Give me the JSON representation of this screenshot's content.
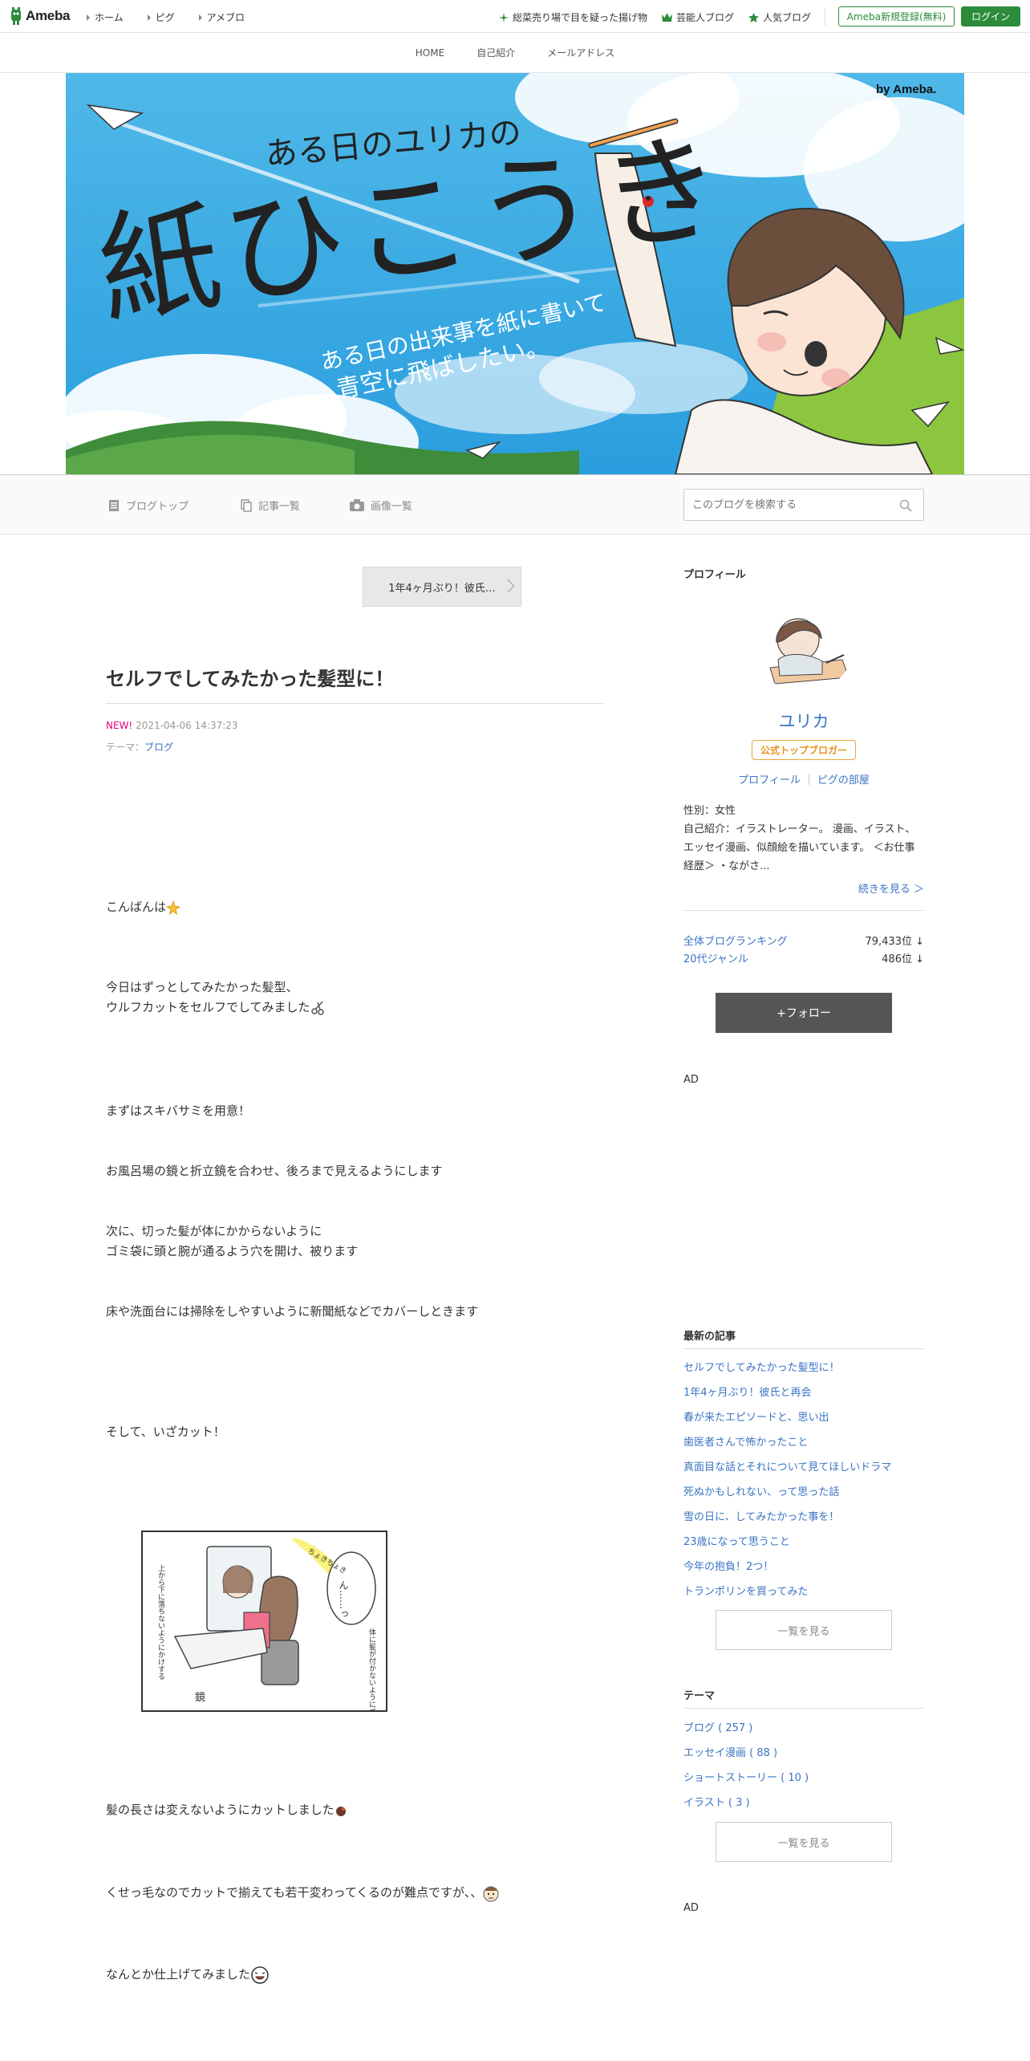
{
  "topbar": {
    "logo_text": "Ameba",
    "nav": [
      "ホーム",
      "ピグ",
      "アメブロ"
    ],
    "links": [
      {
        "label": "総菜売り場で目を疑った揚げ物",
        "icon": "star-plus-icon"
      },
      {
        "label": "芸能人ブログ",
        "icon": "crown-icon"
      },
      {
        "label": "人気ブログ",
        "icon": "star-icon"
      }
    ],
    "register_label": "Ameba新規登録(無料)",
    "login_label": "ログイン"
  },
  "subnav": [
    "HOME",
    "自己紹介",
    "メールアドレス"
  ],
  "banner": {
    "line1": "ある日のユリカの",
    "line2": "紙ひこうき",
    "line3": "ある日の出来事を紙に書いて",
    "line4": "青空に飛ばしたい。",
    "by": "by Ameba."
  },
  "blognav": {
    "top_label": "ブログトップ",
    "list_label": "記事一覧",
    "images_label": "画像一覧",
    "search_placeholder": "このブログを検索する"
  },
  "article": {
    "prev_label": "1年4ヶ月ぶり！彼氏…",
    "title": "セルフでしてみたかった髪型に！",
    "new_label": "NEW!",
    "date": "2021-04-06 14:37:23",
    "theme_prefix": "テーマ：",
    "theme": "ブログ",
    "paragraphs": [
      "こんばんは",
      "今日はずっとしてみたかった髪型、",
      "ウルフカットをセルフでしてみました",
      "まずはスキバサミを用意！",
      "お風呂場の鏡と折立鏡を合わせ、後ろまで見えるようにします",
      "次に、切った髪が体にかからないように",
      "ゴミ袋に頭と腕が通るよう穴を開け、被ります",
      "床や洗面台には掃除をしやすいように新聞紙などでカバーしときます",
      "そして、いざカット！",
      "髪の長さは変えないようにカットしました",
      "くせっ毛なのでカットで揃えても若干変わってくるのが難点ですが、、",
      "なんとか仕上げてみました"
    ],
    "illustration_text": {
      "speech": "ん……っ",
      "note_left": "上から下に落ちないようにかけする",
      "note_right": "体に髪が付かないようにゴミ袋を被る",
      "label_mirror": "鏡",
      "scissors_sfx": "ちょきちょき"
    }
  },
  "sidebar": {
    "profile_heading": "プロフィール",
    "name": "ユリカ",
    "badge": "公式トップブロガー",
    "link_profile": "プロフィール",
    "link_pig": "ピグの部屋",
    "gender": "性別：女性",
    "intro": "自己紹介：イラストレーター。 漫画、イラスト、エッセイ漫画、似顔絵を描いています。 ＜お仕事経歴＞ ・ながさ...",
    "more": "続きを見る ＞",
    "rank_all_label": "全体ブログランキング",
    "rank_all_value": "79,433位 ↓",
    "rank_genre_label": "20代ジャンル",
    "rank_genre_value": "486位 ↓",
    "follow_label": "+フォロー",
    "ad_label": "AD",
    "recent_heading": "最新の記事",
    "recent": [
      "セルフでしてみたかった髪型に！",
      "1年4ヶ月ぶり！彼氏と再会",
      "春が来たエピソードと、思い出",
      "歯医者さんで怖かったこと",
      "真面目な話とそれについて見てほしいドラマ",
      "死ぬかもしれない、って思った話",
      "雪の日に、してみたかった事を！",
      "23歳になって思うこと",
      "今年の抱負！2つ！",
      "トランポリンを買ってみた"
    ],
    "list_more": "一覧を見る",
    "theme_heading": "テーマ",
    "themes": [
      "ブログ ( 257 )",
      "エッセイ漫画 ( 88 )",
      "ショートストーリー ( 10 )",
      "イラスト ( 3 )"
    ]
  },
  "colors": {
    "brand_green": "#2d8c3c",
    "link_blue": "#3b74c3",
    "new_pink": "#e4007f",
    "badge_orange": "#e8931c"
  }
}
